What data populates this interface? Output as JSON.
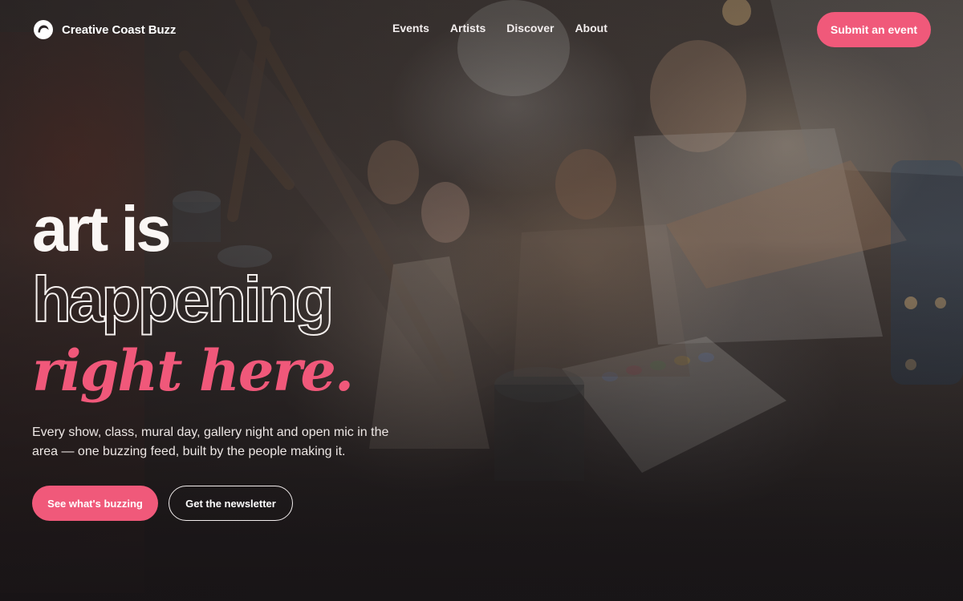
{
  "brand": {
    "name": "Creative Coast Buzz",
    "logo_icon": "swirl-c-logo-icon"
  },
  "nav": {
    "links": [
      {
        "label": "Events"
      },
      {
        "label": "Artists"
      },
      {
        "label": "Discover"
      },
      {
        "label": "About"
      }
    ],
    "cta_label": "Submit an event"
  },
  "hero": {
    "line1": "art is",
    "line2": "happening",
    "line3": "right here.",
    "subtitle": "Every show, class, mural day, gallery night and open mic in the area — one buzzing feed, built by the people making it.",
    "primary_button": "See what's buzzing",
    "secondary_button": "Get the newsletter",
    "background": "photo-collage: children painting at easels, actors on stage"
  },
  "colors": {
    "accent": "#f0597a",
    "text": "#ffffff",
    "background_dark": "#1e1a1b"
  }
}
